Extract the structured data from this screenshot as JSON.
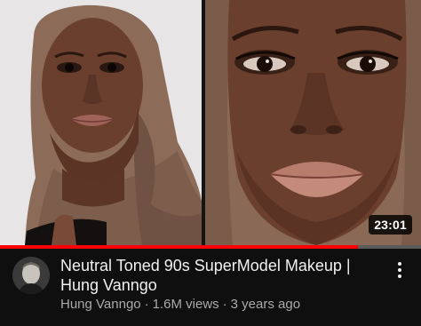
{
  "video": {
    "duration": "23:01",
    "progress_fraction": 0.85,
    "title": "Neutral Toned 90s SuperModel Makeup | Hung Vanngo",
    "channel": "Hung Vanngo",
    "views": "1.6M views",
    "age": "3 years ago",
    "separator": "·"
  },
  "icons": {
    "menu": "more-vert-icon",
    "avatar": "channel-avatar"
  },
  "colors": {
    "progress": "#ff0000",
    "progress_track": "#5b5b5b",
    "background": "#0f0f0f",
    "title_text": "#f1f1f1",
    "secondary_text": "#aaaaaa"
  }
}
